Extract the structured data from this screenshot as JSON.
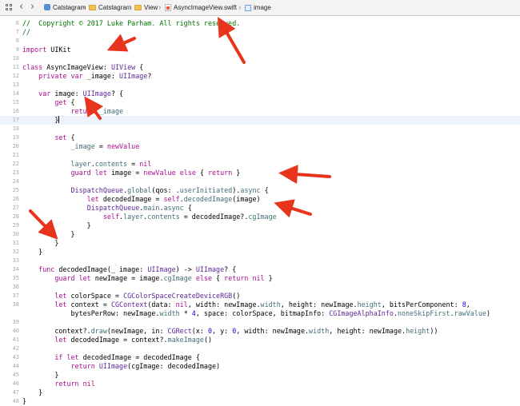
{
  "breadcrumb": {
    "items": [
      {
        "label": "Catstagram",
        "icon": "app-icon"
      },
      {
        "label": "Catstagram",
        "icon": "folder-icon"
      },
      {
        "label": "View",
        "icon": "folder-icon"
      },
      {
        "label": "AsyncImageView.swift",
        "icon": "swift-file-icon"
      },
      {
        "label": "image",
        "icon": "property-icon"
      }
    ]
  },
  "editor": {
    "colors": {
      "keyword": "#aa0d91",
      "type": "#5c2699",
      "comment": "#007400",
      "number": "#1c00cf",
      "arrow": "#e8341c"
    },
    "lines": [
      {
        "n": "6",
        "tokens": [
          [
            "co",
            "//  Copyright © 2017 Luke Parham. All rights reserved."
          ]
        ]
      },
      {
        "n": "7",
        "tokens": [
          [
            "co",
            "//"
          ]
        ]
      },
      {
        "n": "8",
        "tokens": []
      },
      {
        "n": "9",
        "tokens": [
          [
            "kw",
            "import"
          ],
          [
            "",
            " UIKit"
          ]
        ]
      },
      {
        "n": "10",
        "tokens": []
      },
      {
        "n": "11",
        "tokens": [
          [
            "kw",
            "class"
          ],
          [
            "",
            " AsyncImageView: "
          ],
          [
            "ty",
            "UIView"
          ],
          [
            "",
            " {"
          ]
        ]
      },
      {
        "n": "12",
        "tokens": [
          [
            "",
            "    "
          ],
          [
            "kw",
            "private var"
          ],
          [
            "",
            " _image: "
          ],
          [
            "ty",
            "UIImage"
          ],
          [
            "",
            "?"
          ]
        ]
      },
      {
        "n": "13",
        "tokens": []
      },
      {
        "n": "14",
        "tokens": [
          [
            "",
            "    "
          ],
          [
            "kw",
            "var"
          ],
          [
            "",
            " image: "
          ],
          [
            "ty",
            "UIImage"
          ],
          [
            "",
            "? {"
          ]
        ]
      },
      {
        "n": "15",
        "tokens": [
          [
            "",
            "        "
          ],
          [
            "kw",
            "get"
          ],
          [
            "",
            " {"
          ]
        ]
      },
      {
        "n": "16",
        "tokens": [
          [
            "",
            "            "
          ],
          [
            "kw",
            "return"
          ],
          [
            "pr",
            " _image"
          ]
        ]
      },
      {
        "n": "17",
        "cur": true,
        "tokens": [
          [
            "",
            "        }"
          ],
          [
            "cursor",
            ""
          ]
        ]
      },
      {
        "n": "18",
        "tokens": []
      },
      {
        "n": "19",
        "tokens": [
          [
            "",
            "        "
          ],
          [
            "kw",
            "set"
          ],
          [
            "",
            " {"
          ]
        ]
      },
      {
        "n": "20",
        "tokens": [
          [
            "",
            "            "
          ],
          [
            "pr",
            "_image"
          ],
          [
            "",
            " = "
          ],
          [
            "kw",
            "newValue"
          ]
        ]
      },
      {
        "n": "21",
        "tokens": []
      },
      {
        "n": "22",
        "tokens": [
          [
            "",
            "            "
          ],
          [
            "pr",
            "layer"
          ],
          [
            "",
            "."
          ],
          [
            "pr",
            "contents"
          ],
          [
            "",
            " = "
          ],
          [
            "kw",
            "nil"
          ]
        ]
      },
      {
        "n": "23",
        "tokens": [
          [
            "",
            "            "
          ],
          [
            "kw",
            "guard let"
          ],
          [
            "",
            " image = "
          ],
          [
            "kw",
            "newValue"
          ],
          [
            "",
            " "
          ],
          [
            "kw",
            "else"
          ],
          [
            "",
            " { "
          ],
          [
            "kw",
            "return"
          ],
          [
            "",
            " }"
          ]
        ]
      },
      {
        "n": "24",
        "tokens": []
      },
      {
        "n": "25",
        "tokens": [
          [
            "",
            "            "
          ],
          [
            "ty",
            "DispatchQueue"
          ],
          [
            "",
            "."
          ],
          [
            "pr",
            "global"
          ],
          [
            "",
            "(qos: ."
          ],
          [
            "pr",
            "userInitiated"
          ],
          [
            "",
            ")."
          ],
          [
            "pr",
            "async"
          ],
          [
            "",
            " {"
          ]
        ]
      },
      {
        "n": "26",
        "tokens": [
          [
            "",
            "                "
          ],
          [
            "kw",
            "let"
          ],
          [
            "",
            " decodedImage = "
          ],
          [
            "kw",
            "self"
          ],
          [
            "",
            "."
          ],
          [
            "pr",
            "decodedImage"
          ],
          [
            "",
            "(image)"
          ]
        ]
      },
      {
        "n": "27",
        "tokens": [
          [
            "",
            "                "
          ],
          [
            "ty",
            "DispatchQueue"
          ],
          [
            "",
            "."
          ],
          [
            "pr",
            "main"
          ],
          [
            "",
            "."
          ],
          [
            "pr",
            "async"
          ],
          [
            "",
            " {"
          ]
        ]
      },
      {
        "n": "28",
        "tokens": [
          [
            "",
            "                    "
          ],
          [
            "kw",
            "self"
          ],
          [
            "",
            "."
          ],
          [
            "pr",
            "layer"
          ],
          [
            "",
            "."
          ],
          [
            "pr",
            "contents"
          ],
          [
            "",
            " = decodedImage?."
          ],
          [
            "pr",
            "cgImage"
          ]
        ]
      },
      {
        "n": "29",
        "tokens": [
          [
            "",
            "                }"
          ]
        ]
      },
      {
        "n": "30",
        "tokens": [
          [
            "",
            "            }"
          ]
        ]
      },
      {
        "n": "31",
        "tokens": [
          [
            "",
            "        }"
          ]
        ]
      },
      {
        "n": "32",
        "tokens": [
          [
            "",
            "    }"
          ]
        ]
      },
      {
        "n": "33",
        "tokens": []
      },
      {
        "n": "34",
        "tokens": [
          [
            "",
            "    "
          ],
          [
            "kw",
            "func"
          ],
          [
            "",
            " decodedImage(_ image: "
          ],
          [
            "ty",
            "UIImage"
          ],
          [
            "",
            ") -> "
          ],
          [
            "ty",
            "UIImage"
          ],
          [
            "",
            "? {"
          ]
        ]
      },
      {
        "n": "35",
        "tokens": [
          [
            "",
            "        "
          ],
          [
            "kw",
            "guard let"
          ],
          [
            "",
            " newImage = image."
          ],
          [
            "pr",
            "cgImage"
          ],
          [
            "",
            " "
          ],
          [
            "kw",
            "else"
          ],
          [
            "",
            " { "
          ],
          [
            "kw",
            "return nil"
          ],
          [
            "",
            " }"
          ]
        ]
      },
      {
        "n": "36",
        "tokens": []
      },
      {
        "n": "37",
        "tokens": [
          [
            "",
            "        "
          ],
          [
            "kw",
            "let"
          ],
          [
            "",
            " colorSpace = "
          ],
          [
            "ty",
            "CGColorSpaceCreateDeviceRGB"
          ],
          [
            "",
            "()"
          ]
        ]
      },
      {
        "n": "38",
        "tokens": [
          [
            "",
            "        "
          ],
          [
            "kw",
            "let"
          ],
          [
            "",
            " context = "
          ],
          [
            "ty",
            "CGContext"
          ],
          [
            "",
            "(data: "
          ],
          [
            "kw",
            "nil"
          ],
          [
            "",
            ", width: newImage."
          ],
          [
            "pr",
            "width"
          ],
          [
            "",
            ", height: newImage."
          ],
          [
            "pr",
            "height"
          ],
          [
            "",
            ", bitsPerComponent: "
          ],
          [
            "nu",
            "8"
          ],
          [
            "",
            ","
          ]
        ]
      },
      {
        "n": "",
        "tokens": [
          [
            "",
            "            bytesPerRow: newImage."
          ],
          [
            "pr",
            "width"
          ],
          [
            "",
            " * "
          ],
          [
            "nu",
            "4"
          ],
          [
            "",
            ", space: colorSpace, bitmapInfo: "
          ],
          [
            "ty",
            "CGImageAlphaInfo"
          ],
          [
            "",
            "."
          ],
          [
            "pr",
            "noneSkipFirst"
          ],
          [
            "",
            "."
          ],
          [
            "pr",
            "rawValue"
          ],
          [
            "",
            ")"
          ]
        ]
      },
      {
        "n": "39",
        "tokens": []
      },
      {
        "n": "40",
        "tokens": [
          [
            "",
            "        context?."
          ],
          [
            "pr",
            "draw"
          ],
          [
            "",
            "(newImage, in: "
          ],
          [
            "ty",
            "CGRect"
          ],
          [
            "",
            "(x: "
          ],
          [
            "nu",
            "0"
          ],
          [
            "",
            ", y: "
          ],
          [
            "nu",
            "0"
          ],
          [
            "",
            ", width: newImage."
          ],
          [
            "pr",
            "width"
          ],
          [
            "",
            ", height: newImage."
          ],
          [
            "pr",
            "height"
          ],
          [
            "",
            "))"
          ]
        ]
      },
      {
        "n": "41",
        "tokens": [
          [
            "",
            "        "
          ],
          [
            "kw",
            "let"
          ],
          [
            "",
            " decodedImage = context?."
          ],
          [
            "pr",
            "makeImage"
          ],
          [
            "",
            "()"
          ]
        ]
      },
      {
        "n": "42",
        "tokens": []
      },
      {
        "n": "43",
        "tokens": [
          [
            "",
            "        "
          ],
          [
            "kw",
            "if let"
          ],
          [
            "",
            " decodedImage = decodedImage {"
          ]
        ]
      },
      {
        "n": "44",
        "tokens": [
          [
            "",
            "            "
          ],
          [
            "kw",
            "return"
          ],
          [
            "",
            " "
          ],
          [
            "ty",
            "UIImage"
          ],
          [
            "",
            "(cgImage: decodedImage)"
          ]
        ]
      },
      {
        "n": "45",
        "tokens": [
          [
            "",
            "        }"
          ]
        ]
      },
      {
        "n": "46",
        "tokens": [
          [
            "",
            "        "
          ],
          [
            "kw",
            "return nil"
          ]
        ]
      },
      {
        "n": "47",
        "tokens": [
          [
            "",
            "    }"
          ]
        ]
      },
      {
        "n": "48",
        "tokens": [
          [
            "",
            "}"
          ]
        ]
      }
    ]
  }
}
